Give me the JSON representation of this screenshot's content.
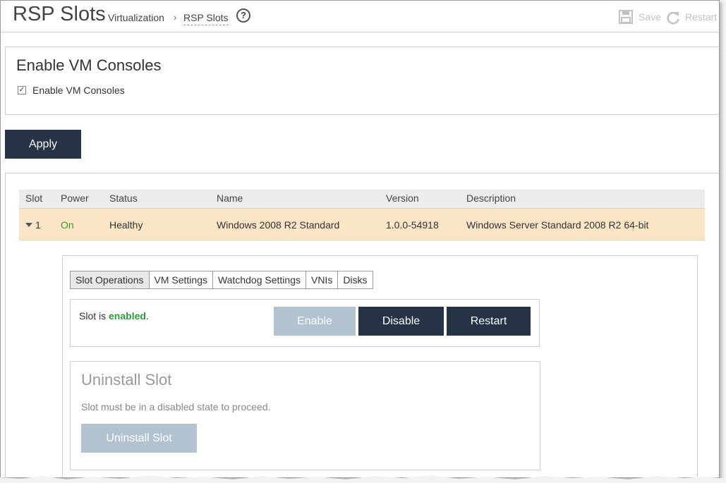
{
  "header": {
    "title": "RSP Slots",
    "breadcrumb": [
      {
        "label": "Virtualization"
      },
      {
        "label": "RSP Slots"
      }
    ],
    "breadcrumb_separator": "›",
    "help_glyph": "?",
    "actions": {
      "save_label": "Save",
      "restart_label": "Restart"
    }
  },
  "vm_consoles": {
    "title": "Enable VM Consoles",
    "checkbox_label": "Enable VM Consoles",
    "checked": true,
    "checkbox_glyph": "✓"
  },
  "apply_label": "Apply",
  "slots_table": {
    "columns": [
      "Slot",
      "Power",
      "Status",
      "Name",
      "Version",
      "Description"
    ],
    "rows": [
      {
        "slot": "1",
        "power": "On",
        "status": "Healthy",
        "name": "Windows 2008 R2 Standard",
        "version": "1.0.0-54918",
        "description": "Windows Server Standard 2008 R2 64-bit",
        "expanded": true
      }
    ]
  },
  "detail": {
    "tabs": [
      {
        "label": "Slot Operations",
        "active": true
      },
      {
        "label": "VM Settings",
        "active": false
      },
      {
        "label": "Watchdog Settings",
        "active": false
      },
      {
        "label": "VNIs",
        "active": false
      },
      {
        "label": "Disks",
        "active": false
      }
    ],
    "slot_operations": {
      "status_prefix": "Slot is ",
      "status_value": "enabled",
      "status_suffix": ".",
      "enable_label": "Enable",
      "disable_label": "Disable",
      "restart_label": "Restart"
    },
    "uninstall": {
      "title": "Uninstall Slot",
      "note": "Slot must be in a disabled state to proceed.",
      "button_label": "Uninstall Slot"
    }
  },
  "colors": {
    "primary_button": "#263245",
    "disabled_button": "#b3c2d1",
    "selected_row": "#fbe5c7",
    "status_ok": "#2e9a3a"
  }
}
